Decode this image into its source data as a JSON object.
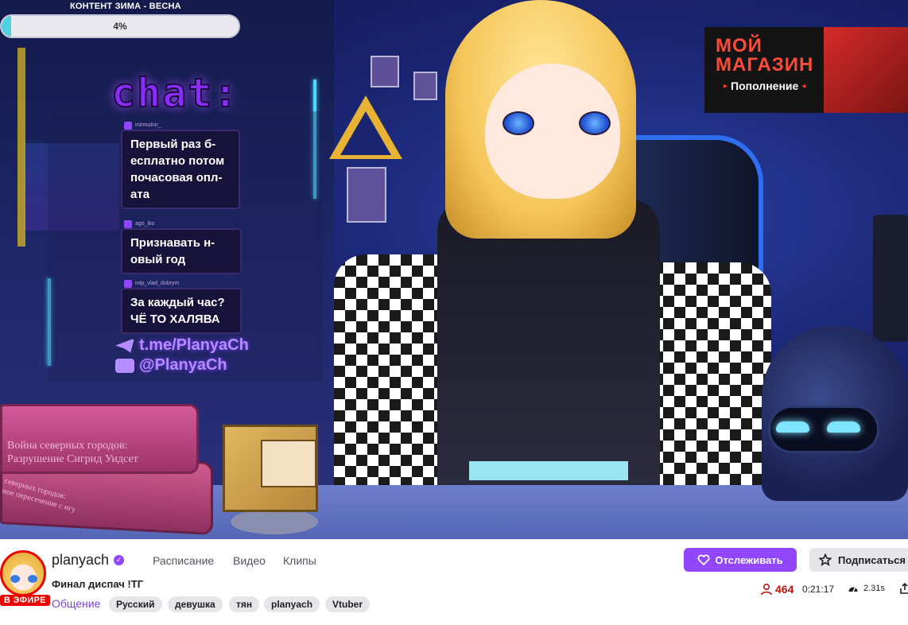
{
  "overlay": {
    "progress_title": "КОНТЕНТ ЗИМА - ВЕСНА",
    "progress_label": "4%",
    "progress_value": 4,
    "chat_logo": "chat:",
    "messages": [
      {
        "user": "mirmulnir_",
        "text": "Первый раз б-\nесплатно потом\nпочасовая опл-\nата"
      },
      {
        "user": "ago_iko",
        "text": "Признавать н-\nовый год"
      },
      {
        "user": "mip_vlad_dobrym",
        "text": "За каждый час?\nЧЁ ТО ХАЛЯВА"
      }
    ],
    "social": {
      "telegram": "t.me/PlanyaCh",
      "youtube": "@PlanyaCh"
    },
    "shop": {
      "title": "МОЙ\nМАГАЗИН",
      "button": "Пополнение"
    },
    "book1_title": "Война северных городов:\nРазрушение Сигрид Уидсет",
    "book2_title": "северных городов:\nное пересечение с нгу"
  },
  "channel": {
    "name": "planyach",
    "live_badge": "В ЭФИРЕ",
    "stream_title": "Финал диспач !ТГ",
    "category": "Общение",
    "tags": [
      "Русский",
      "девушка",
      "тян",
      "planyach",
      "Vtuber"
    ]
  },
  "nav": {
    "schedule": "Расписание",
    "videos": "Видео",
    "clips": "Клипы"
  },
  "actions": {
    "follow": "Отслеживать",
    "subscribe": "Подписаться"
  },
  "stats": {
    "viewers": "464",
    "uptime": "0:21:17",
    "latency": "2.31s"
  },
  "colors": {
    "accent": "#9146ff",
    "live": "#eb0400",
    "viewers": "#bb1411"
  }
}
